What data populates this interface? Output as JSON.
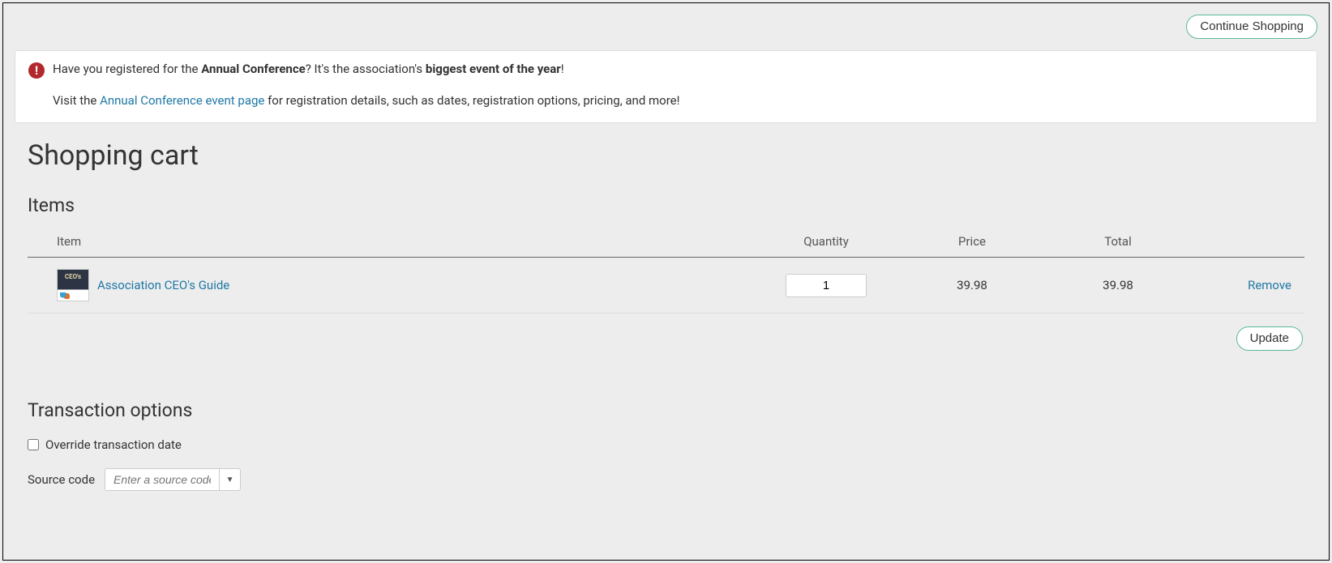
{
  "topbar": {
    "continue_label": "Continue Shopping"
  },
  "alert": {
    "pre": "Have you registered for the ",
    "bold1": "Annual Conference",
    "mid": "? It's the association's ",
    "bold2": "biggest event of the year",
    "post": "!",
    "sub_pre": "Visit the ",
    "sub_link": "Annual Conference event page",
    "sub_post": " for registration details, such as dates, registration options, pricing, and more!"
  },
  "page": {
    "title": "Shopping cart"
  },
  "items": {
    "heading": "Items",
    "columns": {
      "item": "Item",
      "qty": "Quantity",
      "price": "Price",
      "total": "Total"
    },
    "rows": [
      {
        "thumb_text": "CEO's",
        "name": "Association CEO's Guide",
        "qty": "1",
        "price": "39.98",
        "total": "39.98",
        "remove": "Remove"
      }
    ],
    "update_label": "Update"
  },
  "transaction": {
    "heading": "Transaction options",
    "override_label": "Override transaction date",
    "source_label": "Source code",
    "source_placeholder": "Enter a source code"
  }
}
